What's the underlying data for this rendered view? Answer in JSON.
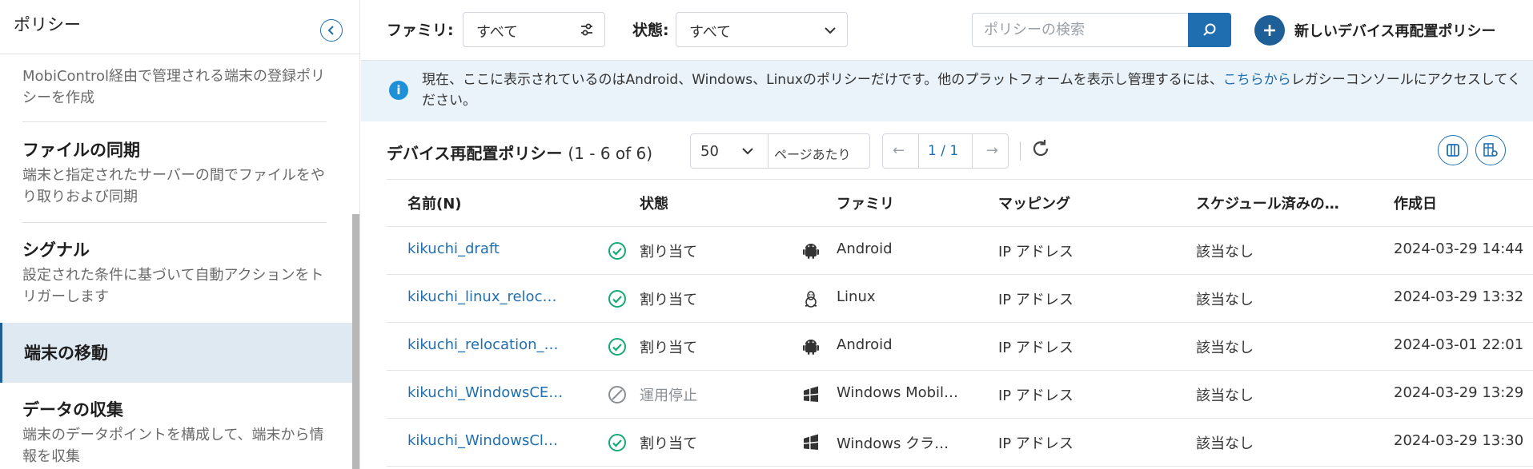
{
  "sidebar": {
    "title": "ポリシー",
    "items": [
      {
        "title": "",
        "desc": "MobiControl経由で管理される端末の登録ポリシーを作成"
      },
      {
        "title": "ファイルの同期",
        "desc": "端末と指定されたサーバーの間でファイルをやり取りおよび同期"
      },
      {
        "title": "シグナル",
        "desc": "設定された条件に基づいて自動アクションをトリガーします"
      },
      {
        "title": "端末の移動",
        "desc": ""
      },
      {
        "title": "データの収集",
        "desc": "端末のデータポイントを構成して、端末から情報を収集"
      }
    ]
  },
  "toolbar": {
    "family_label": "ファミリ:",
    "family_value": "すべて",
    "state_label": "状態:",
    "state_value": "すべて",
    "search_placeholder": "ポリシーの検索",
    "new_label": "新しいデバイス再配置ポリシー"
  },
  "banner": {
    "text_before": "現在、ここに表示されているのはAndroid、Windows、Linuxのポリシーだけです。他のプラットフォームを表示し管理するには、",
    "link": "こちらから",
    "text_after": "レガシーコンソールにアクセスしてください。"
  },
  "list": {
    "title": "デバイス再配置ポリシー",
    "count": "(1 - 6 of 6)",
    "per_page": "50",
    "per_page_unit": "ページあたり",
    "page": "1 / 1"
  },
  "table": {
    "columns": [
      "名前(N)",
      "状態",
      "ファミリ",
      "マッピング",
      "スケジュール済みの…",
      "作成日"
    ],
    "rows": [
      {
        "name": "kikuchi_draft",
        "state": "割り当て",
        "state_icon": "check-circle-icon",
        "family": "Android",
        "family_icon": "android-icon",
        "mapping": "IP アドレス",
        "scheduled": "該当なし",
        "created": "2024-03-29 14:44"
      },
      {
        "name": "kikuchi_linux_reloc…",
        "state": "割り当て",
        "state_icon": "check-circle-icon",
        "family": "Linux",
        "family_icon": "linux-icon",
        "mapping": "IP アドレス",
        "scheduled": "該当なし",
        "created": "2024-03-29 13:32"
      },
      {
        "name": "kikuchi_relocation_…",
        "state": "割り当て",
        "state_icon": "check-circle-icon",
        "family": "Android",
        "family_icon": "android-icon",
        "mapping": "IP アドレス",
        "scheduled": "該当なし",
        "created": "2024-03-01 22:01"
      },
      {
        "name": "kikuchi_WindowsCE…",
        "state": "運用停止",
        "state_icon": "disabled-circle-icon",
        "family": "Windows Mobil…",
        "family_icon": "windows-icon",
        "mapping": "IP アドレス",
        "scheduled": "該当なし",
        "created": "2024-03-29 13:29"
      },
      {
        "name": "kikuchi_WindowsCl…",
        "state": "割り当て",
        "state_icon": "check-circle-icon",
        "family": "Windows クラ…",
        "family_icon": "windows-icon",
        "mapping": "IP アドレス",
        "scheduled": "該当なし",
        "created": "2024-03-29 13:30"
      }
    ]
  },
  "colors": {
    "accent": "#1f6fb0",
    "success": "#19a974",
    "banner_bg": "#eaf3fa",
    "active_bg": "#dfe9f2"
  }
}
